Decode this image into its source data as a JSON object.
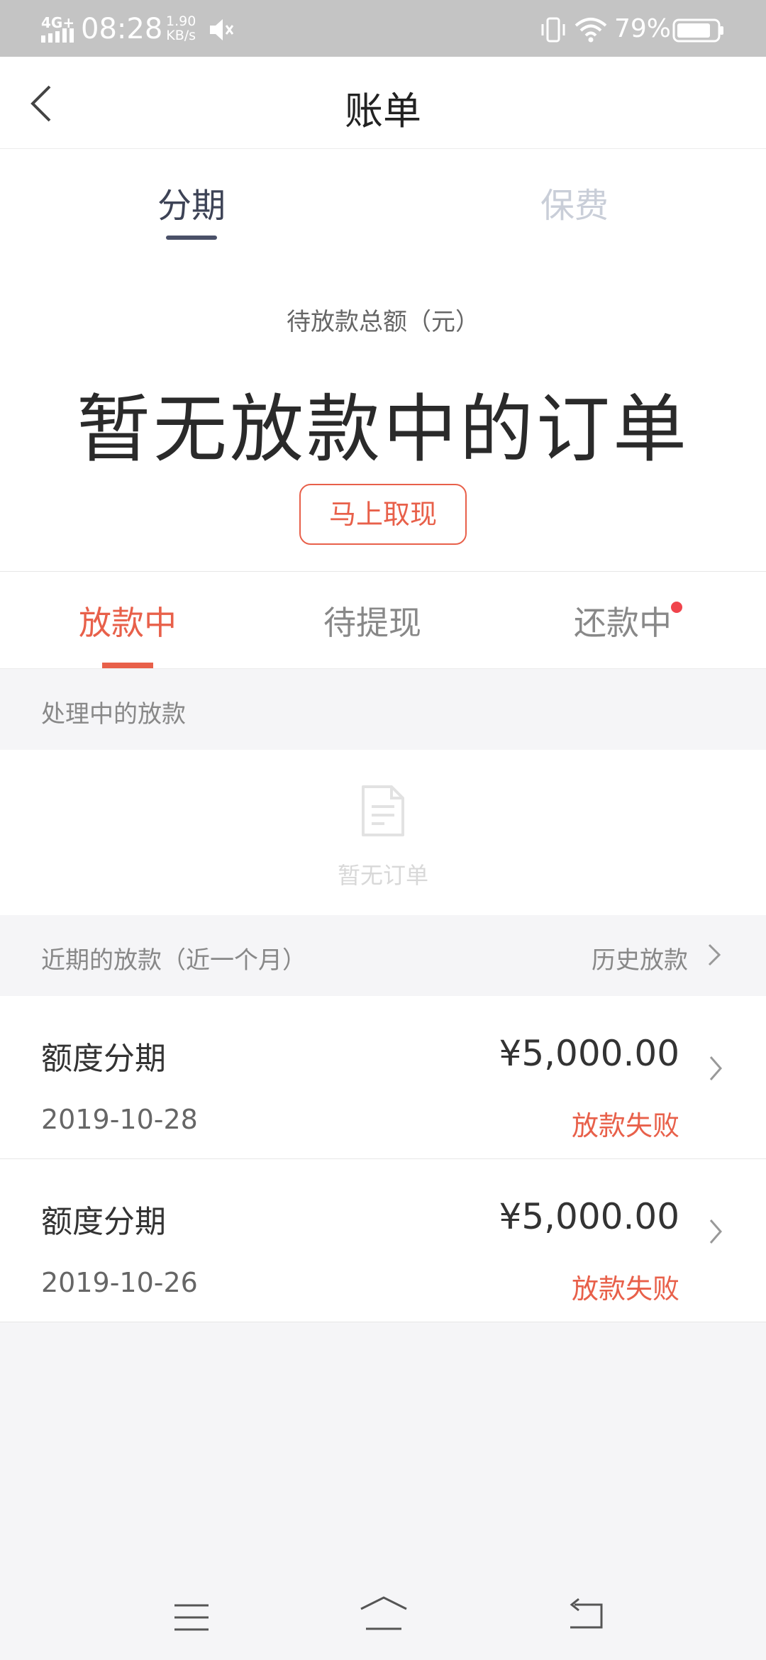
{
  "status_bar": {
    "network": "4G+",
    "time": "08:28",
    "speed_value": "1.90",
    "speed_unit": "KB/s",
    "battery": "79%"
  },
  "header": {
    "title": "账单"
  },
  "top_tabs": [
    {
      "label": "分期",
      "active": true
    },
    {
      "label": "保费",
      "active": false
    }
  ],
  "summary": {
    "label": "待放款总额（元）",
    "value": "暂无放款中的订单",
    "cash_button": "马上取现"
  },
  "sub_tabs": [
    {
      "label": "放款中",
      "active": true
    },
    {
      "label": "待提现",
      "active": false
    },
    {
      "label": "还款中",
      "active": false,
      "badge": true
    }
  ],
  "processing": {
    "title": "处理中的放款",
    "empty_text": "暂无订单"
  },
  "recent": {
    "title": "近期的放款（近一个月）",
    "history_link": "历史放款",
    "items": [
      {
        "title": "额度分期",
        "amount": "¥5,000.00",
        "date": "2019-10-28",
        "status": "放款失败"
      },
      {
        "title": "额度分期",
        "amount": "¥5,000.00",
        "date": "2019-10-26",
        "status": "放款失败"
      }
    ]
  },
  "colors": {
    "accent": "#e8604a",
    "badge": "#f0444c",
    "tab_active": "#3d4356",
    "tab_inactive": "#c9ced8"
  },
  "icons": [
    "signal-icon",
    "mute-icon",
    "vibrate-icon",
    "wifi-icon",
    "battery-icon",
    "back-arrow-icon",
    "document-icon",
    "chevron-right-icon",
    "menu-icon",
    "home-icon",
    "return-icon"
  ]
}
